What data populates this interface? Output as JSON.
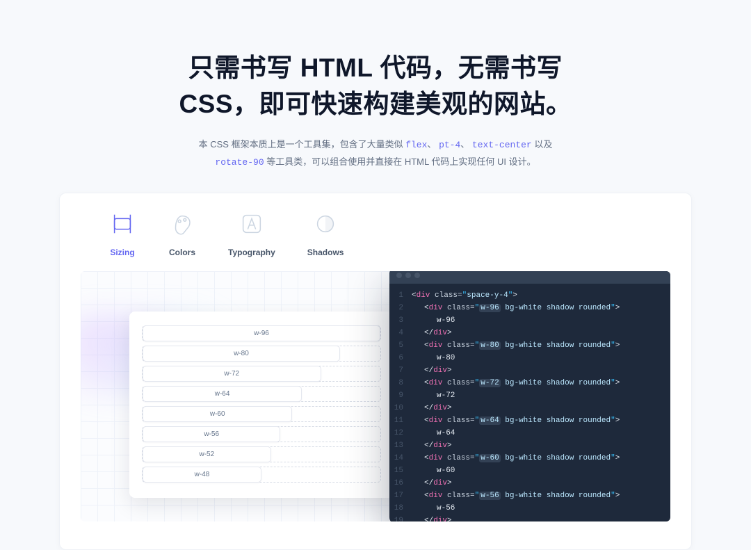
{
  "hero": {
    "line1": "只需书写 HTML 代码，无需书写",
    "line2": "CSS，即可快速构建美观的网站。"
  },
  "subtitle": {
    "pre": "本 CSS 框架本质上是一个工具集，包含了大量类似 ",
    "chip1": "flex",
    "sep1": "、",
    "chip2": "pt-4",
    "sep2": "、",
    "chip3": "text-center",
    "mid": " 以及",
    "chip4": "rotate-90",
    "post": " 等工具类，可以组合使用并直接在 HTML 代码上实现任何 UI 设计。"
  },
  "tabs": [
    {
      "label": "Sizing",
      "icon": "sizing-icon",
      "active": true
    },
    {
      "label": "Colors",
      "icon": "colors-icon",
      "active": false
    },
    {
      "label": "Typography",
      "icon": "typography-icon",
      "active": false
    },
    {
      "label": "Shadows",
      "icon": "shadows-icon",
      "active": false
    }
  ],
  "sizing_bars": [
    "w-96",
    "w-80",
    "w-72",
    "w-64",
    "w-60",
    "w-56",
    "w-52",
    "w-48"
  ],
  "code": {
    "outer_class": "space-y-4",
    "common_classes": "bg-white shadow rounded",
    "widths": [
      "w-96",
      "w-80",
      "w-72",
      "w-64",
      "w-60",
      "w-56"
    ],
    "lines": 19
  }
}
